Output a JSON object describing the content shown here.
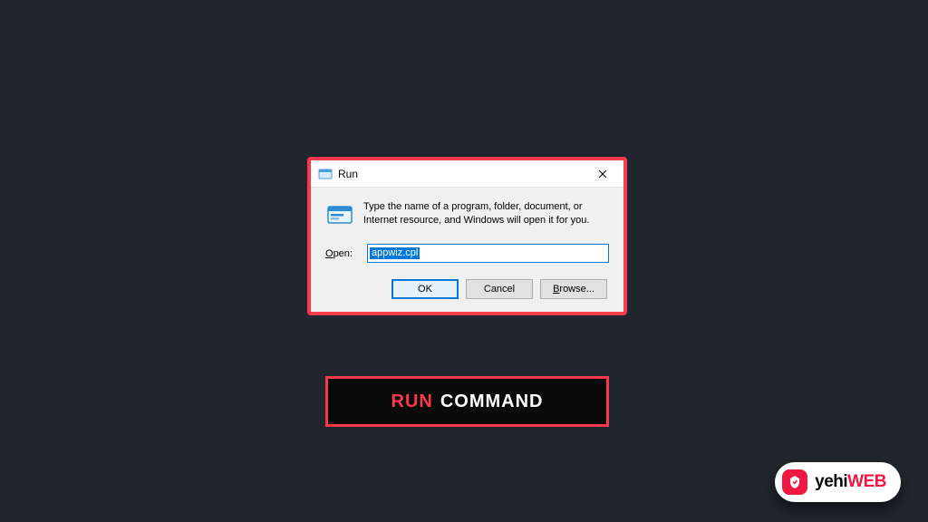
{
  "dialog": {
    "title": "Run",
    "description": "Type the name of a program, folder, document, or Internet resource, and Windows will open it for you.",
    "open_label": "Open:",
    "input_value": "appwiz.cpl",
    "buttons": {
      "ok": "OK",
      "cancel": "Cancel",
      "browse": "Browse..."
    }
  },
  "banner": {
    "word1": "RUN",
    "word2": "COMMAND"
  },
  "watermark": {
    "brand_part1": "yehi",
    "brand_part2": "WEB"
  }
}
